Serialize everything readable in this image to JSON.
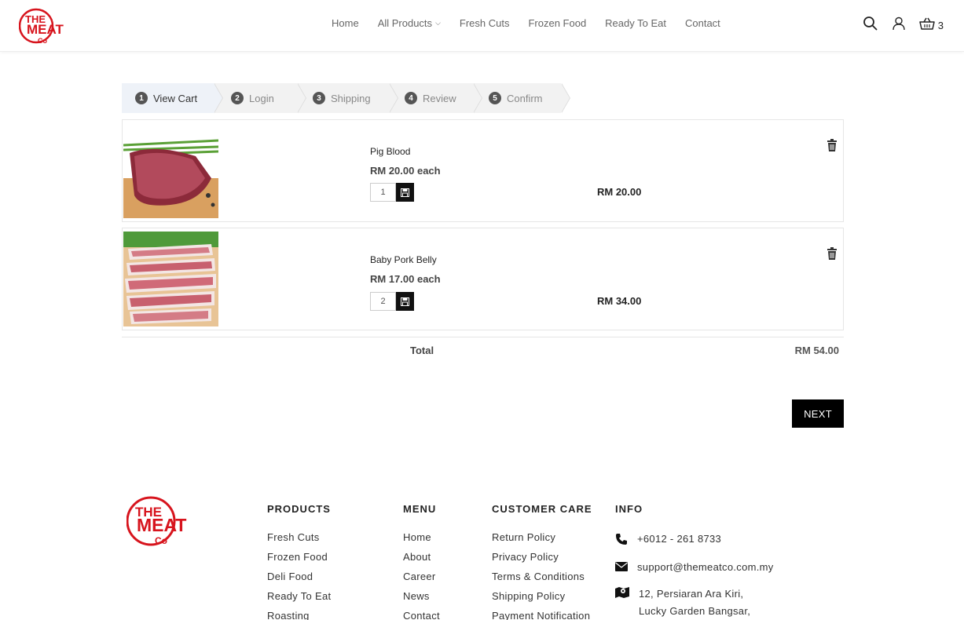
{
  "header": {
    "logo_text": [
      "THE",
      "MEAT",
      "Co"
    ],
    "nav": [
      {
        "label": "Home"
      },
      {
        "label": "All Products",
        "has_dropdown": true
      },
      {
        "label": "Fresh Cuts"
      },
      {
        "label": "Frozen Food"
      },
      {
        "label": "Ready To Eat"
      },
      {
        "label": "Contact"
      }
    ],
    "icons": [
      "search-icon",
      "user-icon",
      "basket-icon"
    ],
    "cart_count": "3"
  },
  "steps": [
    {
      "num": "1",
      "label": "View Cart",
      "active": true
    },
    {
      "num": "2",
      "label": "Login",
      "active": false
    },
    {
      "num": "3",
      "label": "Shipping",
      "active": false
    },
    {
      "num": "4",
      "label": "Review",
      "active": false
    },
    {
      "num": "5",
      "label": "Confirm",
      "active": false
    }
  ],
  "cart": {
    "items": [
      {
        "name": "Pig Blood",
        "unit_price": "RM 20.00 each",
        "qty": "1",
        "line_total": "RM 20.00"
      },
      {
        "name": "Baby Pork Belly",
        "unit_price": "RM 17.00 each",
        "qty": "2",
        "line_total": "RM 34.00"
      }
    ],
    "total_label": "Total",
    "total_value": "RM 54.00",
    "next_label": "NEXT"
  },
  "footer": {
    "products": {
      "title": "PRODUCTS",
      "links": [
        "Fresh Cuts",
        "Frozen Food",
        "Deli Food",
        "Ready To Eat",
        "Roasting"
      ]
    },
    "menu": {
      "title": "MENU",
      "links": [
        "Home",
        "About",
        "Career",
        "News",
        "Contact"
      ]
    },
    "customer_care": {
      "title": "CUSTOMER CARE",
      "links": [
        "Return Policy",
        "Privacy Policy",
        "Terms & Conditions",
        "Shipping Policy",
        "Payment Notification"
      ]
    },
    "info": {
      "title": "INFO",
      "phone": "+6012 - 261 8733",
      "email": "support@themeatco.com.my",
      "address_lines": [
        "12, Persiaran Ara Kiri,",
        "Lucky Garden Bangsar,"
      ]
    }
  },
  "colors": {
    "brand_red": "#d7141d",
    "button_black": "#000000",
    "step_active_bg": "#eef2f8"
  }
}
